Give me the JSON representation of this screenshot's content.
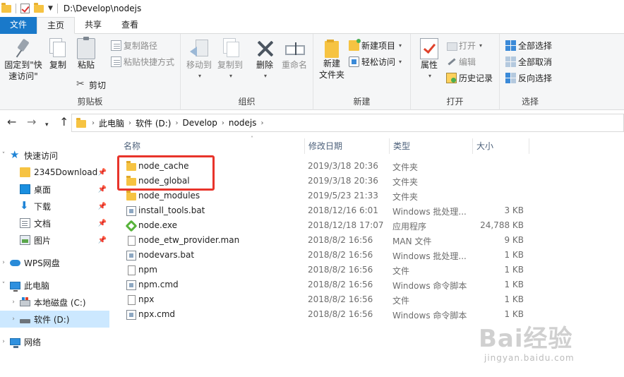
{
  "title_bar": {
    "path": "D:\\Develop\\nodejs"
  },
  "ribbon_tabs": [
    {
      "label": "文件"
    },
    {
      "label": "主页"
    },
    {
      "label": "共享"
    },
    {
      "label": "查看"
    }
  ],
  "ribbon": {
    "clipboard": {
      "pin_quick_access": "固定到\"快\n速访问\"",
      "copy": "复制",
      "paste": "粘贴",
      "copy_path": "复制路径",
      "paste_shortcut": "粘贴快捷方式",
      "cut": "剪切",
      "group_label": "剪贴板"
    },
    "organize": {
      "move_to": "移动到",
      "copy_to": "复制到",
      "delete": "删除",
      "rename": "重命名",
      "group_label": "组织"
    },
    "new": {
      "new_folder": "新建\n文件夹",
      "new_item": "新建项目",
      "easy_access": "轻松访问",
      "group_label": "新建"
    },
    "open": {
      "properties": "属性",
      "open": "打开",
      "edit": "编辑",
      "history": "历史记录",
      "group_label": "打开"
    },
    "select": {
      "select_all": "全部选择",
      "select_none": "全部取消",
      "invert_selection": "反向选择",
      "group_label": "选择"
    }
  },
  "address_bar": {
    "breadcrumbs": [
      "此电脑",
      "软件 (D:)",
      "Develop",
      "nodejs"
    ]
  },
  "nav_pane": {
    "quick_access": "快速访问",
    "items": [
      {
        "label": "2345Download",
        "pinned": true
      },
      {
        "label": "桌面",
        "pinned": true
      },
      {
        "label": "下载",
        "pinned": true
      },
      {
        "label": "文档",
        "pinned": true
      },
      {
        "label": "图片",
        "pinned": true
      }
    ],
    "wps": "WPS网盘",
    "this_pc": "此电脑",
    "drive_c": "本地磁盘 (C:)",
    "drive_d": "软件 (D:)",
    "network": "网络"
  },
  "file_list": {
    "columns": {
      "name": "名称",
      "modified": "修改日期",
      "type": "类型",
      "size": "大小"
    },
    "rows": [
      {
        "name": "node_cache",
        "modified": "2019/3/18 20:36",
        "type": "文件夹",
        "size": "",
        "icon": "folder"
      },
      {
        "name": "node_global",
        "modified": "2019/3/18 20:36",
        "type": "文件夹",
        "size": "",
        "icon": "folder"
      },
      {
        "name": "node_modules",
        "modified": "2019/5/23 21:33",
        "type": "文件夹",
        "size": "",
        "icon": "folder"
      },
      {
        "name": "install_tools.bat",
        "modified": "2018/12/16 6:01",
        "type": "Windows 批处理...",
        "size": "3 KB",
        "icon": "bat"
      },
      {
        "name": "node.exe",
        "modified": "2018/12/18 17:07",
        "type": "应用程序",
        "size": "24,788 KB",
        "icon": "exe"
      },
      {
        "name": "node_etw_provider.man",
        "modified": "2018/8/2 16:56",
        "type": "MAN 文件",
        "size": "9 KB",
        "icon": "file"
      },
      {
        "name": "nodevars.bat",
        "modified": "2018/8/2 16:56",
        "type": "Windows 批处理...",
        "size": "1 KB",
        "icon": "bat"
      },
      {
        "name": "npm",
        "modified": "2018/8/2 16:56",
        "type": "文件",
        "size": "1 KB",
        "icon": "file"
      },
      {
        "name": "npm.cmd",
        "modified": "2018/8/2 16:56",
        "type": "Windows 命令脚本",
        "size": "1 KB",
        "icon": "bat"
      },
      {
        "name": "npx",
        "modified": "2018/8/2 16:56",
        "type": "文件",
        "size": "1 KB",
        "icon": "file"
      },
      {
        "name": "npx.cmd",
        "modified": "2018/8/2 16:56",
        "type": "Windows 命令脚本",
        "size": "1 KB",
        "icon": "bat"
      }
    ]
  },
  "watermark": {
    "brand": "Bai经验",
    "url": "jingyan.baidu.com"
  },
  "colors": {
    "accent": "#1979ca",
    "highlight": "#e8342b",
    "folder": "#f6c342",
    "selected": "#cce8ff"
  }
}
